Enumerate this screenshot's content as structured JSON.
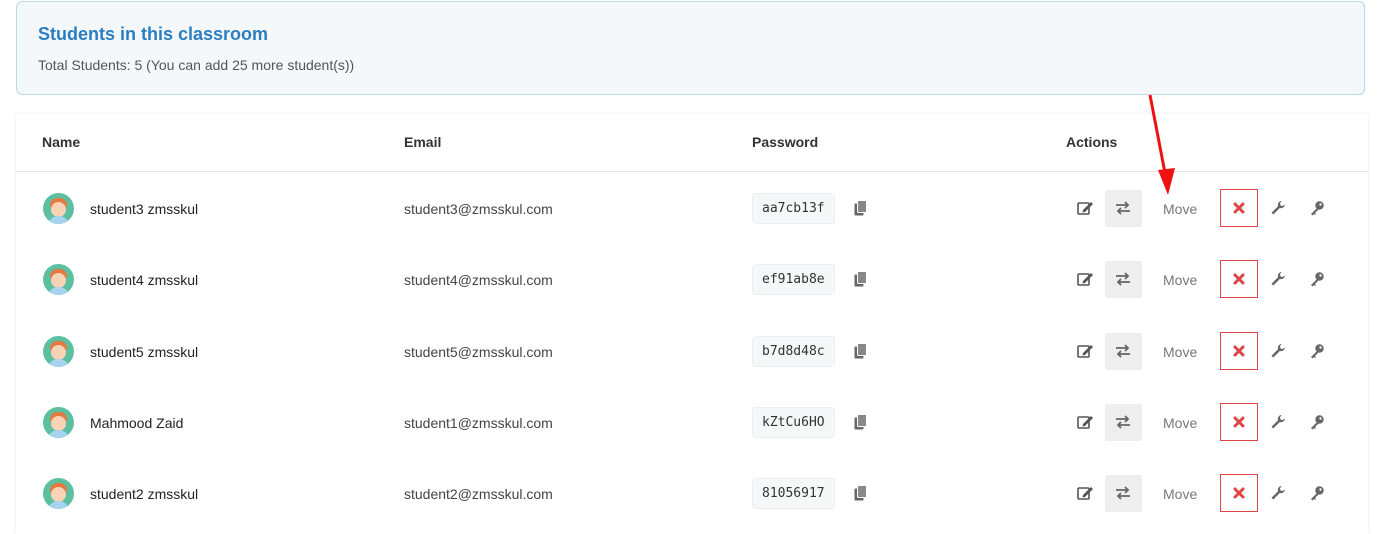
{
  "panel": {
    "title": "Students in this classroom",
    "subtitle": "Total Students: 5 (You can add 25 more student(s))"
  },
  "table": {
    "headers": {
      "name": "Name",
      "email": "Email",
      "password": "Password",
      "actions": "Actions"
    },
    "move_label": "Move",
    "rows": [
      {
        "name": "student3 zmsskul",
        "email": "student3@zmsskul.com",
        "password": "aa7cb13f"
      },
      {
        "name": "student4 zmsskul",
        "email": "student4@zmsskul.com",
        "password": "ef91ab8e"
      },
      {
        "name": "student5 zmsskul",
        "email": "student5@zmsskul.com",
        "password": "b7d8d48c"
      },
      {
        "name": "Mahmood Zaid",
        "email": "student1@zmsskul.com",
        "password": "kZtCu6HO"
      },
      {
        "name": "student2 zmsskul",
        "email": "student2@zmsskul.com",
        "password": "81056917"
      }
    ]
  },
  "icons": {
    "avatar": "student-avatar",
    "copy": "copy-icon",
    "edit": "edit-icon",
    "swap": "swap-arrows-icon",
    "delete": "close-icon",
    "wrench": "wrench-icon",
    "key": "key-icon",
    "annotation": "red-arrow-icon"
  },
  "colors": {
    "title_blue": "#2b7ec1",
    "panel_bg": "#f4f8fb",
    "panel_border": "#bcd9e6",
    "delete_red": "#e04545",
    "annotation_red": "#ee1111",
    "avatar_green": "#5bbfa0"
  }
}
